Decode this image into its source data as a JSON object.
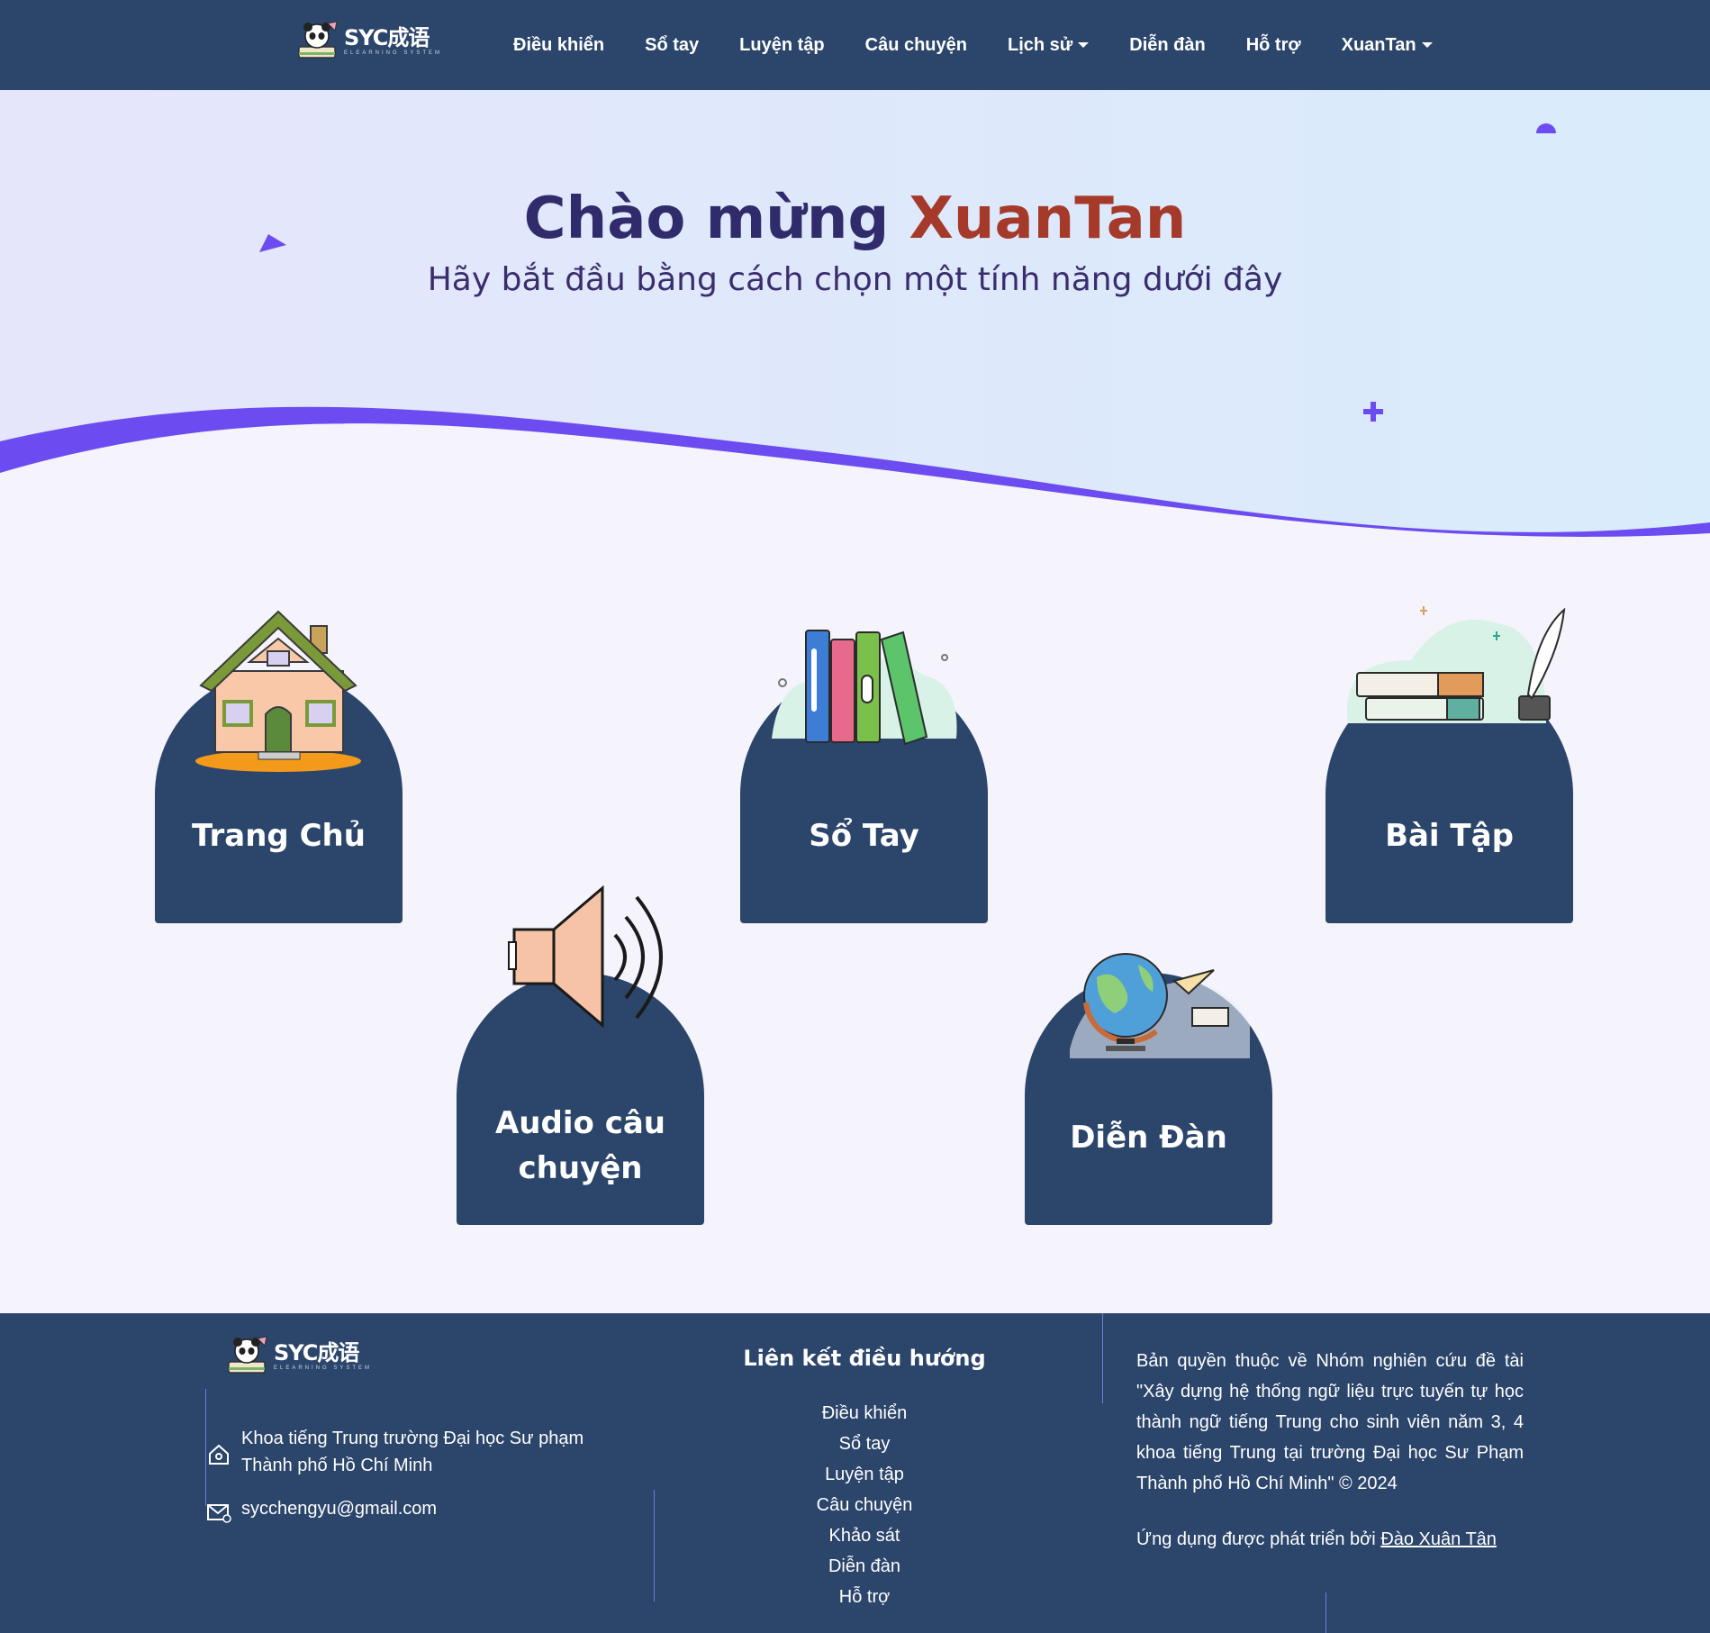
{
  "nav": {
    "brand": "SYC成语",
    "brand_sub": "ELEARNING SYSTEM",
    "items": [
      {
        "label": "Điều khiển",
        "dropdown": false
      },
      {
        "label": "Sổ tay",
        "dropdown": false
      },
      {
        "label": "Luyện tập",
        "dropdown": false
      },
      {
        "label": "Câu chuyện",
        "dropdown": false
      },
      {
        "label": "Lịch sử",
        "dropdown": true
      },
      {
        "label": "Diễn đàn",
        "dropdown": false
      },
      {
        "label": "Hỗ trợ",
        "dropdown": false
      },
      {
        "label": "XuanTan",
        "dropdown": true
      }
    ]
  },
  "hero": {
    "greeting": "Chào mừng",
    "username": "XuanTan",
    "subtitle": "Hãy bắt đầu bằng cách chọn một tính năng dưới đây"
  },
  "cards": [
    {
      "label": "Trang Chủ",
      "icon": "house-icon"
    },
    {
      "label": "Sổ Tay",
      "icon": "books-icon"
    },
    {
      "label": "Bài Tập",
      "icon": "study-books-quill-icon"
    },
    {
      "label": "Audio câu chuyện",
      "icon": "speaker-icon"
    },
    {
      "label": "Diễn Đàn",
      "icon": "globe-icon"
    }
  ],
  "footer": {
    "brand": "SYC成语",
    "brand_sub": "ELEARNING SYSTEM",
    "address": "Khoa tiếng Trung trường Đại học Sư phạm Thành phố Hồ Chí Minh",
    "email": "sycchengyu@gmail.com",
    "nav_title": "Liên kết điều hướng",
    "nav_links": [
      "Điều khiển",
      "Sổ tay",
      "Luyện tập",
      "Câu chuyện",
      "Khảo sát",
      "Diễn đàn",
      "Hỗ trợ"
    ],
    "copyright": "Bản quyền thuộc về Nhóm nghiên cứu đề tài \"Xây dựng hệ thống ngữ liệu trực tuyến tự học thành ngữ tiếng Trung cho sinh viên năm 3, 4 khoa tiếng Trung tại trường Đại học Sư Phạm Thành phố Hồ Chí Minh\" © 2024",
    "developed_by": "Ứng dụng được phát triển bởi",
    "developer": "Đào Xuân Tân"
  },
  "colors": {
    "navy": "#2b456b",
    "accent": "#6c4cf0",
    "title": "#302b6b",
    "username": "#a53a2a"
  }
}
